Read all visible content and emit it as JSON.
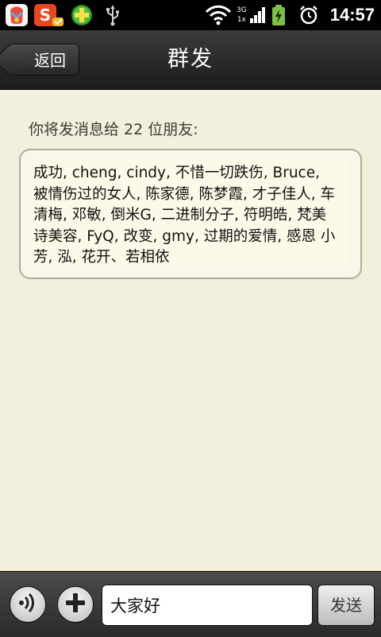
{
  "status_bar": {
    "time": "14:57",
    "notification_icons": [
      "app-store-icon",
      "sogou-input-icon",
      "plus-app-icon",
      "usb-icon"
    ],
    "network_labels": [
      "3G",
      "1x"
    ],
    "status_icons": [
      "wifi-icon",
      "signal-icon",
      "battery-charging-icon",
      "alarm-icon"
    ]
  },
  "header": {
    "back_label": "返回",
    "title": "群发"
  },
  "main": {
    "prompt": "你将发消息给 22 位朋友:",
    "recipients": "成功, cheng, cindy, 不惜一切跌伤, Bruce, 被情伤过的女人, 陈家德, 陈梦霞, 才子佳人, 车清梅, 邓敏, 倒米G, 二进制分子, 符明皓, 梵美诗美容, FyQ, 改变, gmy, 过期的爱情, 感恩 小芳, 泓, 花开、若相依"
  },
  "input_bar": {
    "message_value": "大家好",
    "send_label": "发送",
    "voice_icon": "voice-icon",
    "plus_icon": "plus-icon"
  },
  "colors": {
    "background": "#f3efdd",
    "titlebar": "#2a2a2a",
    "battery": "#7cc242"
  }
}
